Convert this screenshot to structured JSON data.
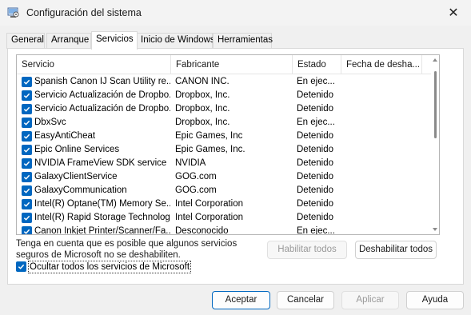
{
  "window": {
    "title": "Configuración del sistema",
    "close_glyph": "✕"
  },
  "tabs": [
    {
      "label": "General"
    },
    {
      "label": "Arranque"
    },
    {
      "label": "Servicios"
    },
    {
      "label": "Inicio de Windows"
    },
    {
      "label": "Herramientas"
    }
  ],
  "active_tab": "Servicios",
  "table": {
    "headers": [
      "Servicio",
      "Fabricante",
      "Estado",
      "Fecha de desha..."
    ],
    "rows": [
      {
        "name": "Spanish Canon IJ Scan Utility re...",
        "vendor": "CANON INC.",
        "status": "En ejec...",
        "checked": true
      },
      {
        "name": "Servicio Actualización de Dropbo...",
        "vendor": "Dropbox, Inc.",
        "status": "Detenido",
        "checked": true
      },
      {
        "name": "Servicio Actualización de Dropbo...",
        "vendor": "Dropbox, Inc.",
        "status": "Detenido",
        "checked": true
      },
      {
        "name": "DbxSvc",
        "vendor": "Dropbox, Inc.",
        "status": "En ejec...",
        "checked": true
      },
      {
        "name": "EasyAntiCheat",
        "vendor": "Epic Games, Inc",
        "status": "Detenido",
        "checked": true
      },
      {
        "name": "Epic Online Services",
        "vendor": "Epic Games, Inc.",
        "status": "Detenido",
        "checked": true
      },
      {
        "name": "NVIDIA FrameView SDK service",
        "vendor": "NVIDIA",
        "status": "Detenido",
        "checked": true
      },
      {
        "name": "GalaxyClientService",
        "vendor": "GOG.com",
        "status": "Detenido",
        "checked": true
      },
      {
        "name": "GalaxyCommunication",
        "vendor": "GOG.com",
        "status": "Detenido",
        "checked": true
      },
      {
        "name": "Intel(R) Optane(TM) Memory Se...",
        "vendor": "Intel Corporation",
        "status": "Detenido",
        "checked": true
      },
      {
        "name": "Intel(R) Rapid Storage Technology",
        "vendor": "Intel Corporation",
        "status": "Detenido",
        "checked": true
      },
      {
        "name": "Canon Inkjet Printer/Scanner/Fa...",
        "vendor": "Desconocido",
        "status": "En ejec...",
        "checked": true
      }
    ]
  },
  "note": "Tenga en cuenta que es posible que algunos servicios seguros de Microsoft no se deshabiliten.",
  "buttons": {
    "enable_all": "Habilitar todos",
    "disable_all": "Deshabilitar todos",
    "accept": "Aceptar",
    "cancel": "Cancelar",
    "apply": "Aplicar",
    "help": "Ayuda"
  },
  "hide_ms": {
    "label": "Ocultar todos los servicios de Microsoft",
    "checked": true
  },
  "colors": {
    "accent": "#0067c0"
  }
}
